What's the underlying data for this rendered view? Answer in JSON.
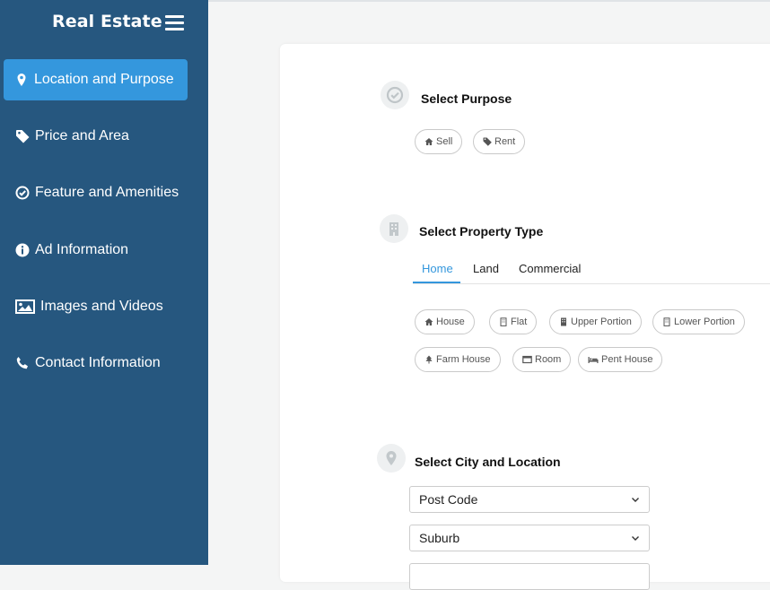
{
  "sidebar": {
    "brand": "Real Estate",
    "items": [
      {
        "label": "Location and Purpose",
        "icon": "map-marker-icon",
        "active": true
      },
      {
        "label": "Price and Area",
        "icon": "tag-icon"
      },
      {
        "label": "Feature and Amenities",
        "icon": "check-circle-icon"
      },
      {
        "label": "Ad Information",
        "icon": "info-circle-icon"
      },
      {
        "label": "Images and Videos",
        "icon": "image-icon"
      },
      {
        "label": "Contact Information",
        "icon": "phone-icon"
      }
    ]
  },
  "purpose": {
    "title": "Select Purpose",
    "options": [
      {
        "label": "Sell",
        "icon": "home-icon"
      },
      {
        "label": "Rent",
        "icon": "tag-icon"
      }
    ]
  },
  "property_type": {
    "title": "Select Property Type",
    "tabs": [
      "Home",
      "Land",
      "Commercial"
    ],
    "active_tab": "Home",
    "options": [
      {
        "label": "House",
        "icon": "home-icon"
      },
      {
        "label": "Flat",
        "icon": "building-icon"
      },
      {
        "label": "Upper Portion",
        "icon": "building-icon"
      },
      {
        "label": "Lower Portion",
        "icon": "building-outline-icon"
      },
      {
        "label": "Farm House",
        "icon": "tree-icon"
      },
      {
        "label": "Room",
        "icon": "window-icon"
      },
      {
        "label": "Pent House",
        "icon": "bed-icon"
      }
    ]
  },
  "city_location": {
    "title": "Select City and Location",
    "selects": [
      {
        "value": "Post Code"
      },
      {
        "value": "Suburb"
      }
    ]
  },
  "colors": {
    "sidebar": "#26577f",
    "accent": "#3497dd"
  }
}
